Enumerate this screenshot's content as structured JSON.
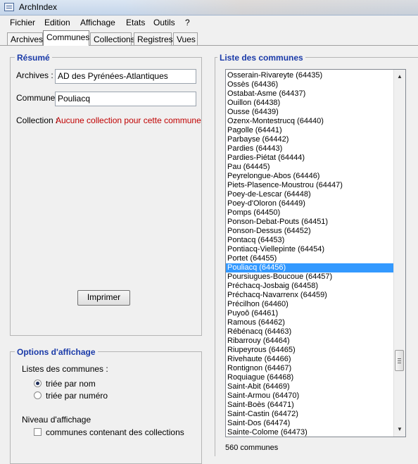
{
  "window": {
    "title": "ArchIndex"
  },
  "menu": [
    {
      "label": "Fichier"
    },
    {
      "label": "Edition"
    },
    {
      "label": "Affichage"
    },
    {
      "label": "Etats"
    },
    {
      "label": "Outils"
    },
    {
      "label": "?"
    }
  ],
  "tabs": [
    {
      "label": "Archives"
    },
    {
      "label": "Communes"
    },
    {
      "label": "Collections"
    },
    {
      "label": "Registres"
    },
    {
      "label": "Vues"
    }
  ],
  "resume": {
    "title": "Résumé",
    "archives_label": "Archives :",
    "archives_value": "AD des Pyrénées-Atlantiques",
    "commune_label": "Commune :",
    "commune_value": "Pouliacq",
    "collection_label": "Collection :",
    "collection_value": "Aucune collection pour cette commune",
    "print_label": "Imprimer"
  },
  "options": {
    "title": "Options d'affichage",
    "list_label": "Listes des communes :",
    "sort_by_name": "triée par nom",
    "sort_by_number": "triée par numéro",
    "level_label": "Niveau d'affichage",
    "with_collections": "communes contenant des collections"
  },
  "communes": {
    "title": "Liste des communes",
    "items": [
      "Osserain-Rivareyte (64435)",
      "Ossès (64436)",
      "Ostabat-Asme (64437)",
      "Ouillon (64438)",
      "Ousse (64439)",
      "Ozenx-Montestrucq (64440)",
      "Pagolle (64441)",
      "Parbayse (64442)",
      "Pardies (64443)",
      "Pardies-Piétat (64444)",
      "Pau (64445)",
      "Peyrelongue-Abos (64446)",
      "Piets-Plasence-Moustrou (64447)",
      "Poey-de-Lescar (64448)",
      "Poey-d'Oloron (64449)",
      "Pomps (64450)",
      "Ponson-Debat-Pouts (64451)",
      "Ponson-Dessus (64452)",
      "Pontacq (64453)",
      "Pontiacq-Viellepinte (64454)",
      "Portet (64455)",
      "Pouliacq (64456)",
      "Poursiugues-Boucoue (64457)",
      "Préchacq-Josbaig (64458)",
      "Préchacq-Navarrenx (64459)",
      "Précilhon (64460)",
      "Puyoô (64461)",
      "Ramous (64462)",
      "Rébénacq (64463)",
      "Ribarrouy (64464)",
      "Riupeyrous (64465)",
      "Rivehaute (64466)",
      "Rontignon (64467)",
      "Roquiague (64468)",
      "Saint-Abit (64469)",
      "Saint-Armou (64470)",
      "Saint-Boès (64471)",
      "Saint-Castin (64472)",
      "Saint-Dos (64474)",
      "Sainte-Colome (64473)"
    ],
    "selected_index": 21,
    "count_text": "560 communes"
  },
  "colors": {
    "legend": "#1a3aa8",
    "selection": "#3399ff",
    "warning": "#c00000"
  }
}
